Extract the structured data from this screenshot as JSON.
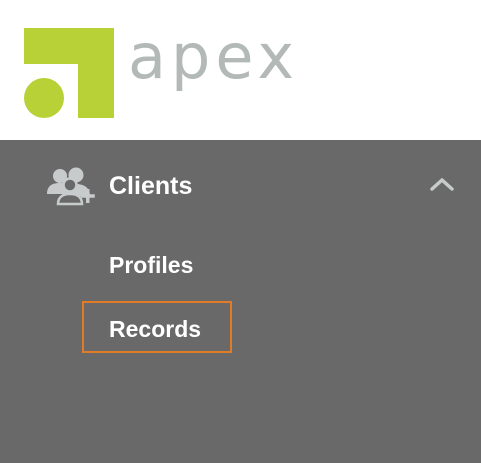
{
  "brand": {
    "name": "apex",
    "colors": {
      "mark": "#b8d137",
      "text": "#b3b9b7"
    }
  },
  "nav": {
    "group": {
      "icon": "users-add-icon",
      "label": "Clients",
      "expanded": true,
      "chevron": "chevron-up-icon"
    },
    "items": [
      {
        "label": "Profiles",
        "highlighted": false
      },
      {
        "label": "Records",
        "highlighted": true
      }
    ]
  },
  "colors": {
    "sidebar_bg": "#696969",
    "header_bg": "#ffffff",
    "highlight": "#e07b27",
    "icon": "#c8cbcc"
  }
}
